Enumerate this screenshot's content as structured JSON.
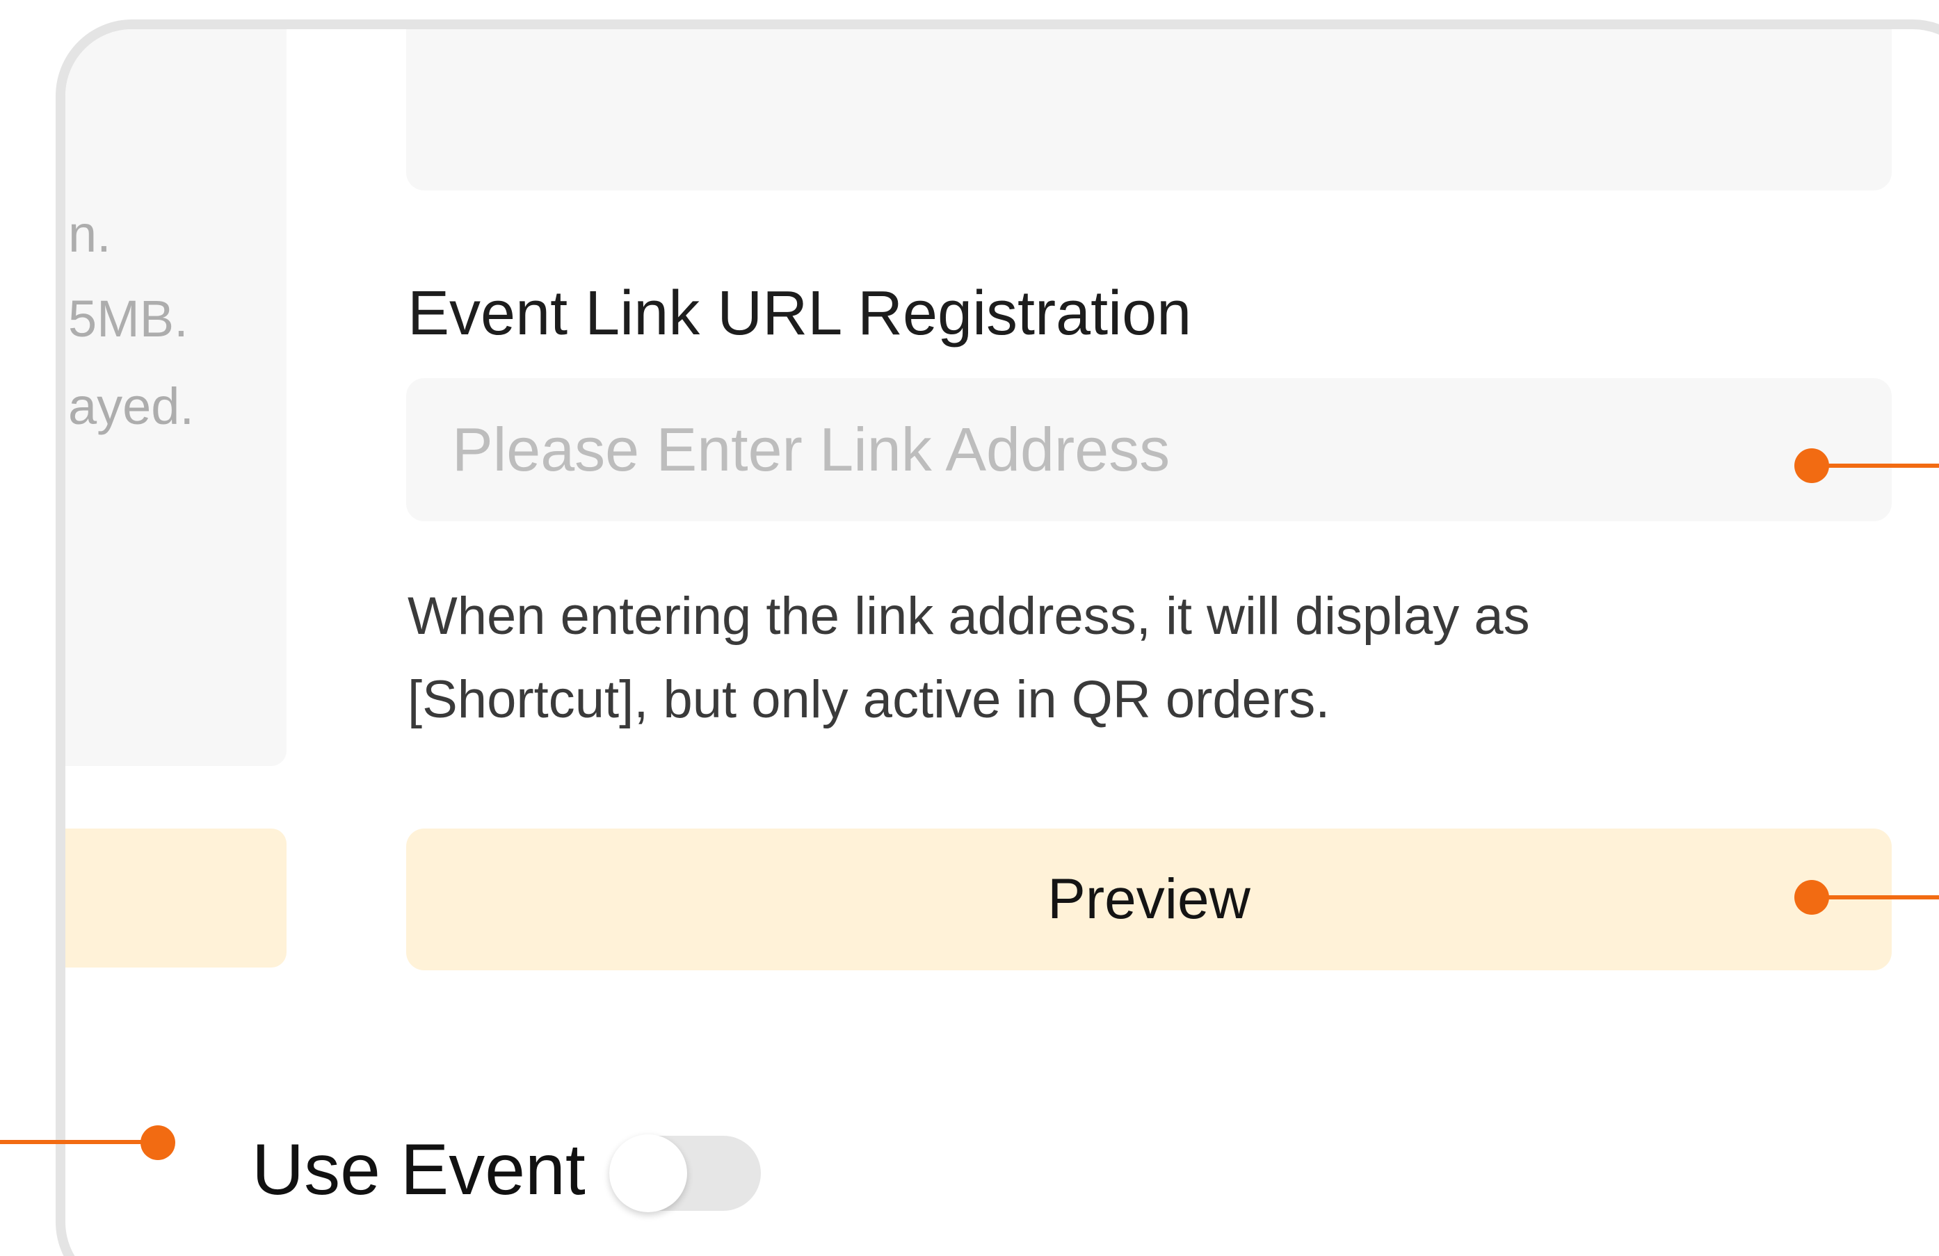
{
  "left_panel": {
    "info_lines": [
      "n.",
      "5MB.",
      "ayed."
    ]
  },
  "event_link": {
    "title": "Event Link URL Registration",
    "input_placeholder": "Please Enter Link Address",
    "input_value": "",
    "help_line_1": "When entering the link address, it will display as",
    "help_line_2": "[Shortcut], but only active in QR orders."
  },
  "preview_button": {
    "label": "Preview"
  },
  "use_event": {
    "label": "Use Event",
    "enabled": false
  },
  "colors": {
    "callout": "#f26b12",
    "button_bg": "#fff2d8",
    "field_bg": "#f7f7f7",
    "device_border": "#e4e4e4"
  }
}
